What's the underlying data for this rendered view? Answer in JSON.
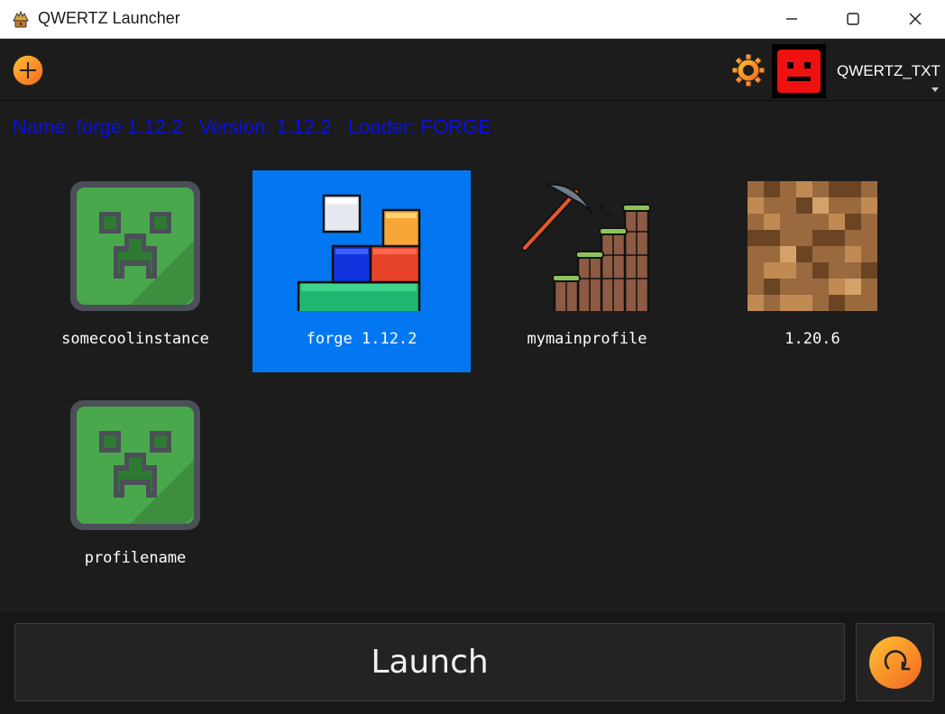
{
  "window": {
    "title": "QWERTZ Launcher"
  },
  "toolbar": {
    "add_icon": "plus-circle-icon",
    "settings_icon": "gear-icon",
    "username": "QWERTZ_TXT"
  },
  "info": {
    "text": "Name: forge 1.12.2   Version: 1.12.2   Loader: FORGE",
    "color": "#0a10e8"
  },
  "profiles": [
    {
      "name": "somecoolinstance",
      "icon": "creeper-icon",
      "selected": false
    },
    {
      "name": "forge 1.12.2",
      "icon": "forge-blocks-icon",
      "selected": true
    },
    {
      "name": "mymainprofile",
      "icon": "pickaxe-stairs-icon",
      "selected": false
    },
    {
      "name": "1.20.6",
      "icon": "dirt-block-icon",
      "selected": false
    },
    {
      "name": "profilename",
      "icon": "creeper-icon",
      "selected": false
    }
  ],
  "actions": {
    "launch_label": "Launch",
    "refresh_icon": "refresh-icon"
  },
  "colors": {
    "selected_tile": "#0377f2",
    "accent_orange": "#f7931e"
  }
}
